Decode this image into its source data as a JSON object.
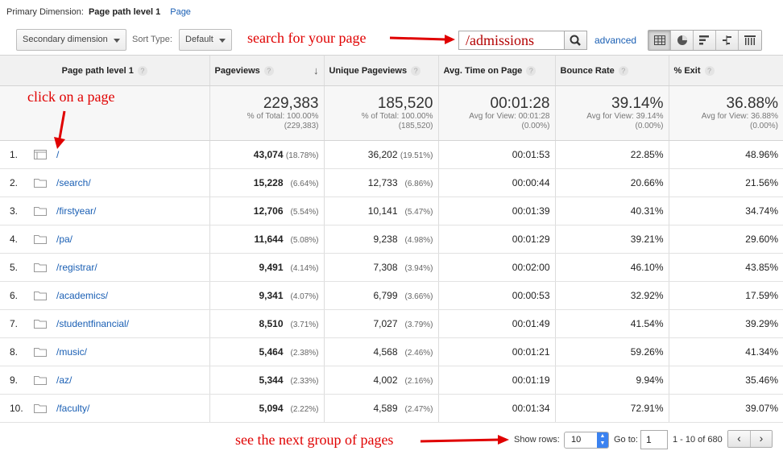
{
  "dimensions": {
    "label": "Primary Dimension:",
    "selected": "Page path level 1",
    "link": "Page"
  },
  "toolbar": {
    "secondary_dimension": "Secondary dimension",
    "sort_type_label": "Sort Type:",
    "sort_type_value": "Default",
    "search_value": "/admissions",
    "advanced_link": "advanced",
    "view_icons": [
      "table-icon",
      "pie-chart-icon",
      "performance-bar-icon",
      "comparison-icon",
      "pivot-icon"
    ]
  },
  "annotations": {
    "search": "search for your page",
    "click": "click on a page",
    "next": "see the next group of pages",
    "color": "#e00000"
  },
  "table": {
    "headers": [
      "Page path level 1",
      "Pageviews",
      "Unique Pageviews",
      "Avg. Time on Page",
      "Bounce Rate",
      "% Exit"
    ],
    "totals": [
      {
        "big": "229,383",
        "l1": "% of Total: 100.00%",
        "l2": "(229,383)"
      },
      {
        "big": "185,520",
        "l1": "% of Total: 100.00%",
        "l2": "(185,520)"
      },
      {
        "big": "00:01:28",
        "l1": "Avg for View: 00:01:28",
        "l2": "(0.00%)"
      },
      {
        "big": "39.14%",
        "l1": "Avg for View: 39.14%",
        "l2": "(0.00%)"
      },
      {
        "big": "36.88%",
        "l1": "Avg for View: 36.88%",
        "l2": "(0.00%)"
      }
    ],
    "rows": [
      {
        "n": "1.",
        "path": "/",
        "pv": "43,074",
        "pvp": "(18.78%)",
        "upv": "36,202",
        "upvp": "(19.51%)",
        "time": "00:01:53",
        "bounce": "22.85%",
        "exit": "48.96%"
      },
      {
        "n": "2.",
        "path": "/search/",
        "pv": "15,228",
        "pvp": "(6.64%)",
        "upv": "12,733",
        "upvp": "(6.86%)",
        "time": "00:00:44",
        "bounce": "20.66%",
        "exit": "21.56%"
      },
      {
        "n": "3.",
        "path": "/firstyear/",
        "pv": "12,706",
        "pvp": "(5.54%)",
        "upv": "10,141",
        "upvp": "(5.47%)",
        "time": "00:01:39",
        "bounce": "40.31%",
        "exit": "34.74%"
      },
      {
        "n": "4.",
        "path": "/pa/",
        "pv": "11,644",
        "pvp": "(5.08%)",
        "upv": "9,238",
        "upvp": "(4.98%)",
        "time": "00:01:29",
        "bounce": "39.21%",
        "exit": "29.60%"
      },
      {
        "n": "5.",
        "path": "/registrar/",
        "pv": "9,491",
        "pvp": "(4.14%)",
        "upv": "7,308",
        "upvp": "(3.94%)",
        "time": "00:02:00",
        "bounce": "46.10%",
        "exit": "43.85%"
      },
      {
        "n": "6.",
        "path": "/academics/",
        "pv": "9,341",
        "pvp": "(4.07%)",
        "upv": "6,799",
        "upvp": "(3.66%)",
        "time": "00:00:53",
        "bounce": "32.92%",
        "exit": "17.59%"
      },
      {
        "n": "7.",
        "path": "/studentfinancial/",
        "pv": "8,510",
        "pvp": "(3.71%)",
        "upv": "7,027",
        "upvp": "(3.79%)",
        "time": "00:01:49",
        "bounce": "41.54%",
        "exit": "39.29%"
      },
      {
        "n": "8.",
        "path": "/music/",
        "pv": "5,464",
        "pvp": "(2.38%)",
        "upv": "4,568",
        "upvp": "(2.46%)",
        "time": "00:01:21",
        "bounce": "59.26%",
        "exit": "41.34%"
      },
      {
        "n": "9.",
        "path": "/az/",
        "pv": "5,344",
        "pvp": "(2.33%)",
        "upv": "4,002",
        "upvp": "(2.16%)",
        "time": "00:01:19",
        "bounce": "9.94%",
        "exit": "35.46%"
      },
      {
        "n": "10.",
        "path": "/faculty/",
        "pv": "5,094",
        "pvp": "(2.22%)",
        "upv": "4,589",
        "upvp": "(2.47%)",
        "time": "00:01:34",
        "bounce": "72.91%",
        "exit": "39.07%"
      }
    ]
  },
  "footer": {
    "show_rows_label": "Show rows:",
    "show_rows_value": "10",
    "goto_label": "Go to:",
    "goto_value": "1",
    "range": "1 - 10 of 680",
    "prev": "‹",
    "next": "›"
  }
}
